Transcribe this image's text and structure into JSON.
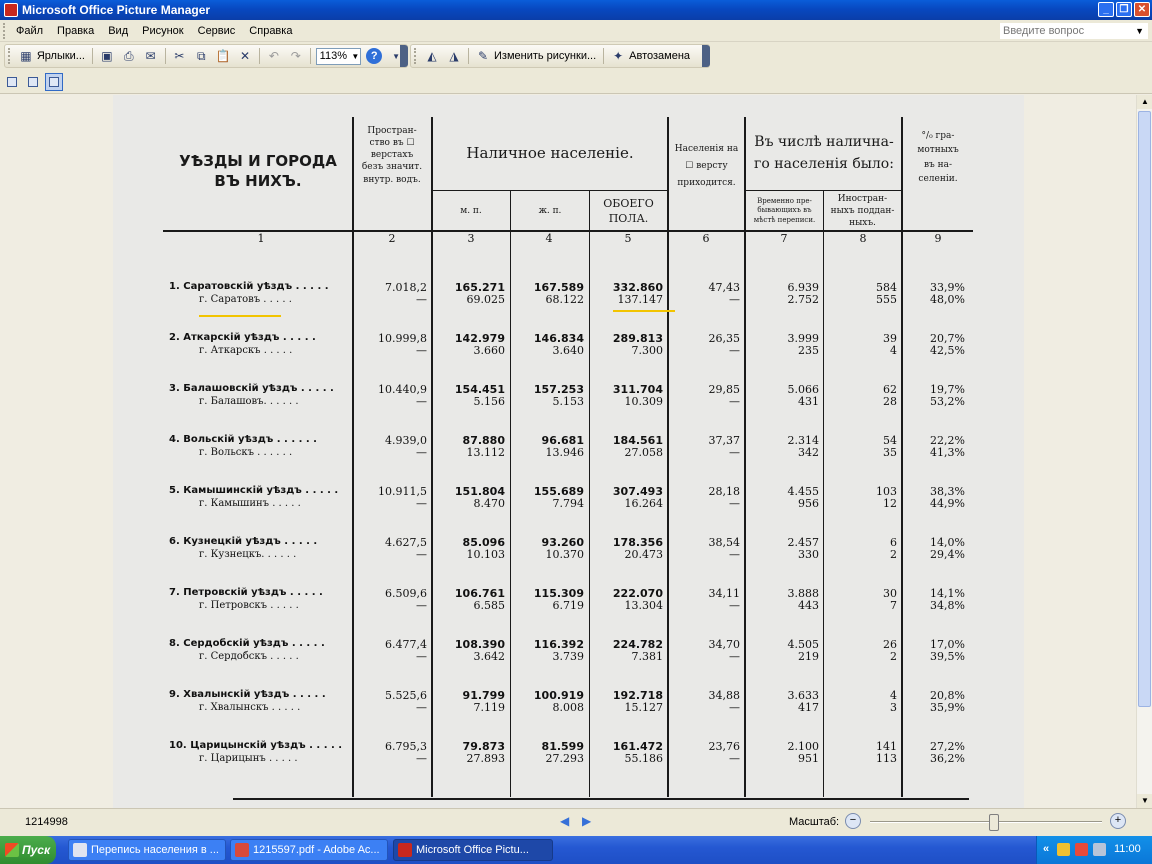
{
  "window": {
    "title": "Microsoft Office Picture Manager",
    "minimize": "_",
    "restore": "❐",
    "close": "✕"
  },
  "menu": {
    "items": [
      "Файл",
      "Правка",
      "Вид",
      "Рисунок",
      "Сервис",
      "Справка"
    ],
    "ask_placeholder": "Введите вопрос"
  },
  "toolbar": {
    "shortcuts_label": "Ярлыки...",
    "zoom_value": "113%",
    "edit_pictures_label": "Изменить рисунки...",
    "autocorrect_label": "Автозамена"
  },
  "status": {
    "count": "1214998",
    "zoom_label": "Масштаб:"
  },
  "taskbar": {
    "start_label": "Пуск",
    "tasks": [
      "Перепись населения в ...",
      "1215597.pdf - Adobe Ac...",
      "Microsoft Office Pictu..."
    ],
    "clock": "11:00",
    "tray_chevron": "«"
  },
  "document": {
    "header": {
      "col1": "УѢЗДЫ И ГОРОДА\nВЪ НИХЪ.",
      "col2": "Простран-\nство въ ☐\nверстахъ\nбезъ значит.\nвнутр. водъ.",
      "group_population": "Наличное населеніе.",
      "col3": "м. п.",
      "col4": "ж. п.",
      "col5": "ОБОЕГО\nПОЛА.",
      "col6": "Населенія на\n☐ версту\nприходится.",
      "group_among": "Въ числѣ налична-\nго населенія было:",
      "col7": "Временно пре-\nбывающихъ въ\nмѣстѣ переписи.",
      "col8": "Иностран-\nныхъ поддан-\nныхъ.",
      "col9": "°/₀ гра-\nмотныхъ\nвъ на-\nселеніи.",
      "numbers": [
        "1",
        "2",
        "3",
        "4",
        "5",
        "6",
        "7",
        "8",
        "9"
      ]
    },
    "rows": [
      {
        "name": "1. Саратовскій уѣздъ . . . . .",
        "city": "г. Саратовъ . . . . .",
        "area": "7.018,2",
        "area_city": "—",
        "m": "165.271",
        "m_city": "69.025",
        "f": "167.589",
        "f_city": "68.122",
        "t": "332.860",
        "t_city": "137.147",
        "dens": "47,43",
        "dens_city": "—",
        "temp": "6.939",
        "temp_city": "2.752",
        "for": "584",
        "for_city": "555",
        "lit": "33,9%",
        "lit_city": "48,0%"
      },
      {
        "name": "2. Аткарскій уѣздъ . . . . .",
        "city": "г. Аткарскъ . . . . .",
        "area": "10.999,8",
        "area_city": "—",
        "m": "142.979",
        "m_city": "3.660",
        "f": "146.834",
        "f_city": "3.640",
        "t": "289.813",
        "t_city": "7.300",
        "dens": "26,35",
        "dens_city": "—",
        "temp": "3.999",
        "temp_city": "235",
        "for": "39",
        "for_city": "4",
        "lit": "20,7%",
        "lit_city": "42,5%"
      },
      {
        "name": "3. Балашовскій уѣздъ . . . . .",
        "city": "г. Балашовъ. . . . . .",
        "area": "10.440,9",
        "area_city": "—",
        "m": "154.451",
        "m_city": "5.156",
        "f": "157.253",
        "f_city": "5.153",
        "t": "311.704",
        "t_city": "10.309",
        "dens": "29,85",
        "dens_city": "—",
        "temp": "5.066",
        "temp_city": "431",
        "for": "62",
        "for_city": "28",
        "lit": "19,7%",
        "lit_city": "53,2%"
      },
      {
        "name": "4. Вольскій уѣздъ . . . . . .",
        "city": "г. Вольскъ . . . . . .",
        "area": "4.939,0",
        "area_city": "—",
        "m": "87.880",
        "m_city": "13.112",
        "f": "96.681",
        "f_city": "13.946",
        "t": "184.561",
        "t_city": "27.058",
        "dens": "37,37",
        "dens_city": "—",
        "temp": "2.314",
        "temp_city": "342",
        "for": "54",
        "for_city": "35",
        "lit": "22,2%",
        "lit_city": "41,3%"
      },
      {
        "name": "5. Камышинскій уѣздъ . . . . .",
        "city": "г. Камышинъ . . . . .",
        "area": "10.911,5",
        "area_city": "—",
        "m": "151.804",
        "m_city": "8.470",
        "f": "155.689",
        "f_city": "7.794",
        "t": "307.493",
        "t_city": "16.264",
        "dens": "28,18",
        "dens_city": "—",
        "temp": "4.455",
        "temp_city": "956",
        "for": "103",
        "for_city": "12",
        "lit": "38,3%",
        "lit_city": "44,9%"
      },
      {
        "name": "6. Кузнецкій уѣздъ . . . . .",
        "city": "г. Кузнецкъ. . . . . .",
        "area": "4.627,5",
        "area_city": "—",
        "m": "85.096",
        "m_city": "10.103",
        "f": "93.260",
        "f_city": "10.370",
        "t": "178.356",
        "t_city": "20.473",
        "dens": "38,54",
        "dens_city": "—",
        "temp": "2.457",
        "temp_city": "330",
        "for": "6",
        "for_city": "2",
        "lit": "14,0%",
        "lit_city": "29,4%"
      },
      {
        "name": "7. Петровскій уѣздъ . . . . .",
        "city": "г. Петровскъ . . . . .",
        "area": "6.509,6",
        "area_city": "—",
        "m": "106.761",
        "m_city": "6.585",
        "f": "115.309",
        "f_city": "6.719",
        "t": "222.070",
        "t_city": "13.304",
        "dens": "34,11",
        "dens_city": "—",
        "temp": "3.888",
        "temp_city": "443",
        "for": "30",
        "for_city": "7",
        "lit": "14,1%",
        "lit_city": "34,8%"
      },
      {
        "name": "8. Сердобскій уѣздъ . . . . .",
        "city": "г. Сердобскъ . . . . .",
        "area": "6.477,4",
        "area_city": "—",
        "m": "108.390",
        "m_city": "3.642",
        "f": "116.392",
        "f_city": "3.739",
        "t": "224.782",
        "t_city": "7.381",
        "dens": "34,70",
        "dens_city": "—",
        "temp": "4.505",
        "temp_city": "219",
        "for": "26",
        "for_city": "2",
        "lit": "17,0%",
        "lit_city": "39,5%"
      },
      {
        "name": "9. Хвалынскій уѣздъ . . . . .",
        "city": "г. Хвалынскъ . . . . .",
        "area": "5.525,6",
        "area_city": "—",
        "m": "91.799",
        "m_city": "7.119",
        "f": "100.919",
        "f_city": "8.008",
        "t": "192.718",
        "t_city": "15.127",
        "dens": "34,88",
        "dens_city": "—",
        "temp": "3.633",
        "temp_city": "417",
        "for": "4",
        "for_city": "3",
        "lit": "20,8%",
        "lit_city": "35,9%"
      },
      {
        "name": "10. Царицынскій уѣздъ . . . . .",
        "city": "г. Царицынъ . . . . .",
        "area": "6.795,3",
        "area_city": "—",
        "m": "79.873",
        "m_city": "27.893",
        "f": "81.599",
        "f_city": "27.293",
        "t": "161.472",
        "t_city": "55.186",
        "dens": "23,76",
        "dens_city": "—",
        "temp": "2.100",
        "temp_city": "951",
        "for": "141",
        "for_city": "113",
        "lit": "27,2%",
        "lit_city": "36,2%"
      }
    ]
  }
}
